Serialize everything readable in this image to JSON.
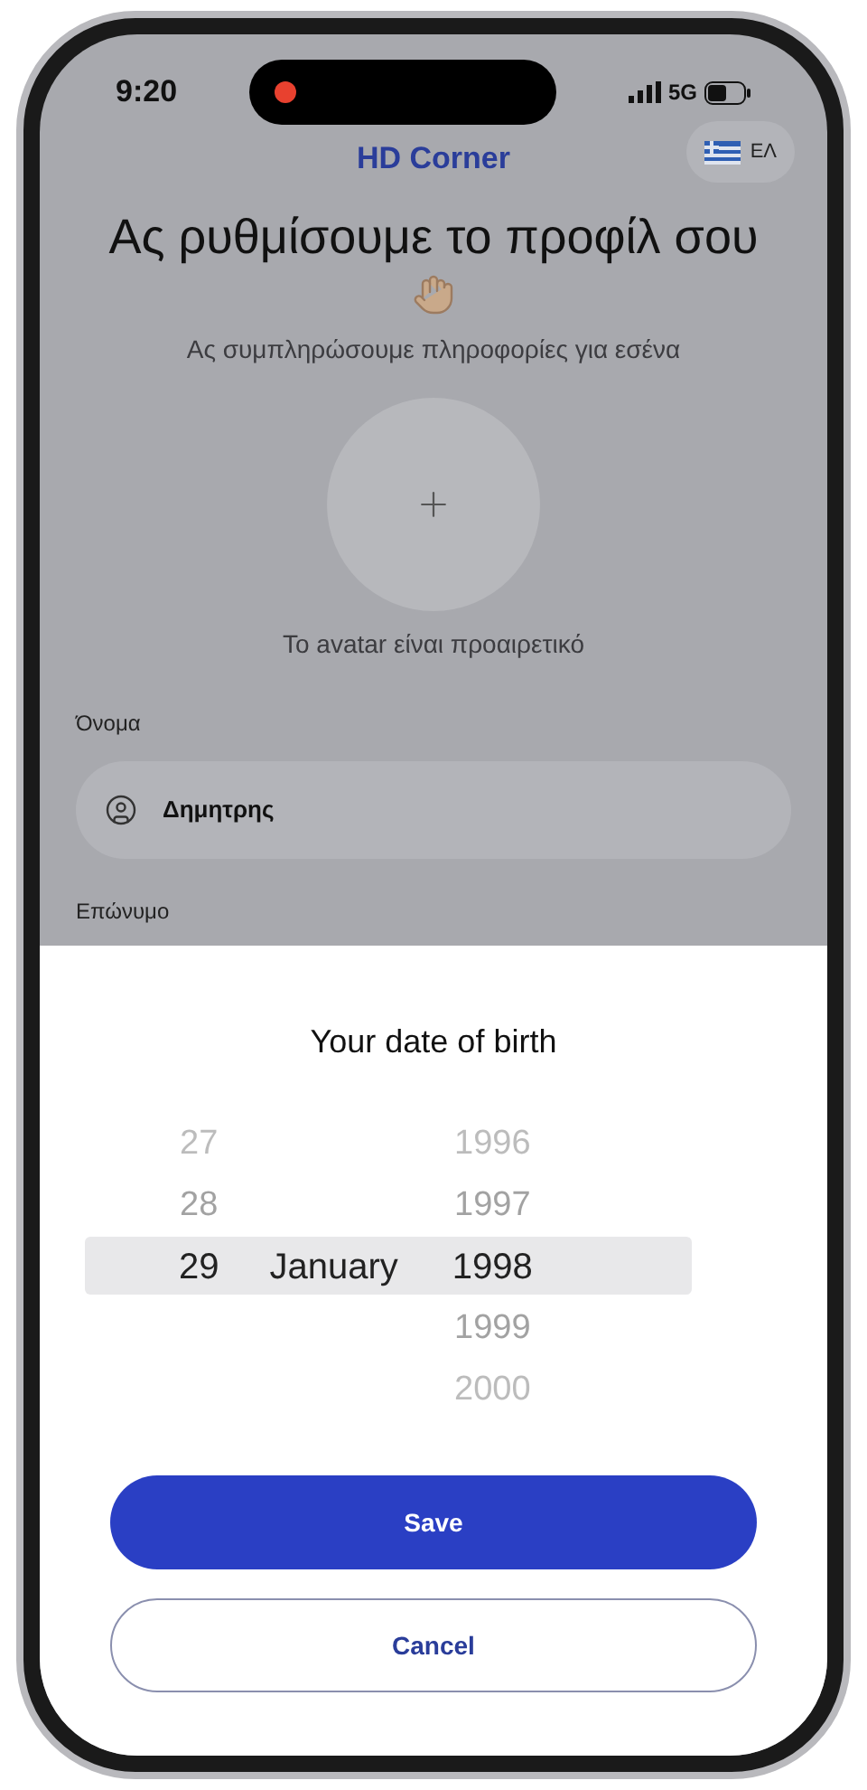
{
  "status_bar": {
    "time": "9:20",
    "network": "5G"
  },
  "header": {
    "title": "HD Corner",
    "language": "ΕΛ"
  },
  "heading": "Ας ρυθμίσουμε το προφίλ σου",
  "subtitle": "Ας συμπληρώσουμε πληροφορίες για εσένα",
  "avatar_hint": "Το avatar είναι προαιρετικό",
  "fields": [
    {
      "label": "Όνομα",
      "value": "Δημητρης"
    }
  ],
  "next_label": "Επώνυμο",
  "sheet": {
    "title": "Your date of birth",
    "columns": [
      {
        "items": [
          {
            "text": "27",
            "selected": false
          },
          {
            "text": "28",
            "selected": false
          },
          {
            "text": "29",
            "selected": true
          }
        ]
      },
      {
        "items": [
          {
            "text": "January",
            "selected": true
          }
        ]
      },
      {
        "items": [
          {
            "text": "1996",
            "selected": false
          },
          {
            "text": "1997",
            "selected": false
          },
          {
            "text": "1998",
            "selected": true
          },
          {
            "text": "1999",
            "selected": false
          },
          {
            "text": "2000",
            "selected": false
          }
        ]
      }
    ],
    "buttons": [
      {
        "label": "Save",
        "kind": "primary"
      },
      {
        "label": "Cancel",
        "kind": "secondary"
      }
    ]
  }
}
